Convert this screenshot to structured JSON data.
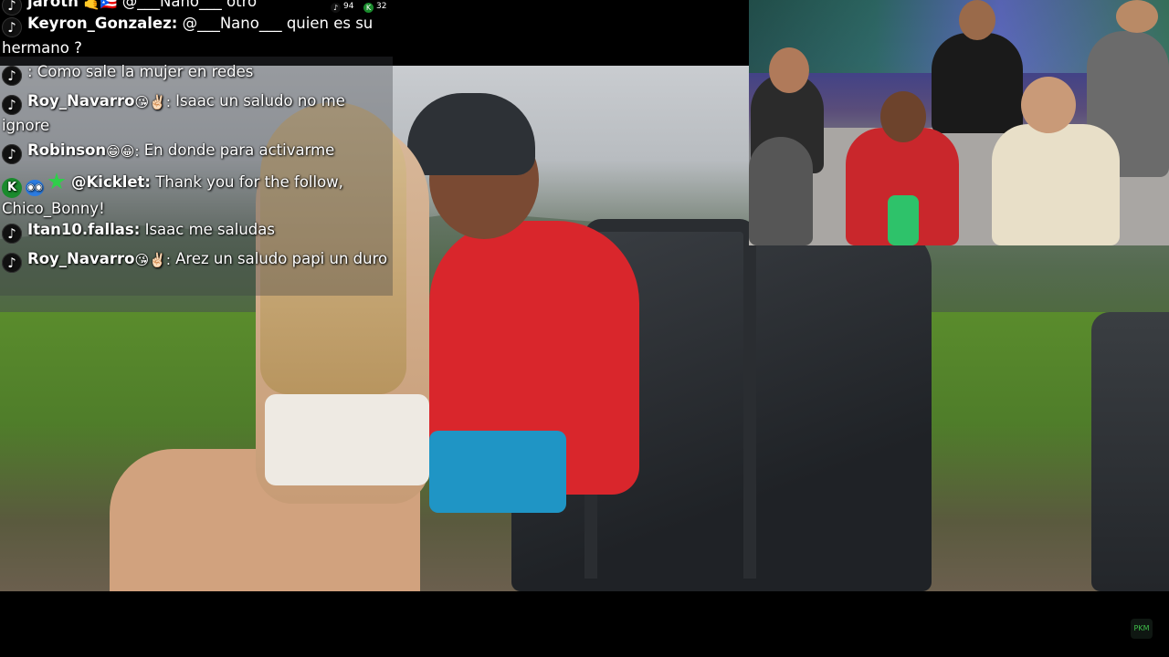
{
  "stream": {
    "viewer_counts": {
      "tiktok": "94",
      "kick": "32"
    },
    "corner_logo": "PKM"
  },
  "chat": {
    "messages": [
      {
        "platform": "tiktok",
        "user": "jaroth",
        "emojis": "🤙🇵🇷",
        "text": "@___Nano___ otro",
        "partial": true
      },
      {
        "platform": "tiktok",
        "user": "Keyron_Gonzalez:",
        "emojis": "",
        "text": "@___Nano___ quien es su hermano ?"
      },
      {
        "platform": "tiktok",
        "user": "",
        "emojis": "",
        "text": ": Como sale la mujer en redes"
      },
      {
        "platform": "tiktok",
        "user": "Roy_Navarro",
        "emojis": "😘✌🏻:",
        "text": "Isaac un saludo no me ignore"
      },
      {
        "platform": "tiktok",
        "user": "Robinson",
        "emojis": "😁😀:",
        "text": "En donde para activarme"
      },
      {
        "platform": "kick",
        "user": "@Kicklet:",
        "emojis": "",
        "text": "Thank you for the follow, Chico_Bonny!"
      },
      {
        "platform": "tiktok",
        "user": "Itan10.fallas:",
        "emojis": "",
        "text": "Isaac me saludas"
      },
      {
        "platform": "tiktok",
        "user": "Roy_Navarro",
        "emojis": "😘✌🏻:",
        "text": "Arez un saludo papi un duro"
      }
    ]
  },
  "icons": {
    "tiktok": "tiktok-icon",
    "kick": "kick-icon",
    "bot": "bot-badge-icon",
    "verified": "green-star-badge-icon"
  },
  "colors": {
    "kick_green": "#1a8b2d",
    "text": "#ffffff"
  }
}
